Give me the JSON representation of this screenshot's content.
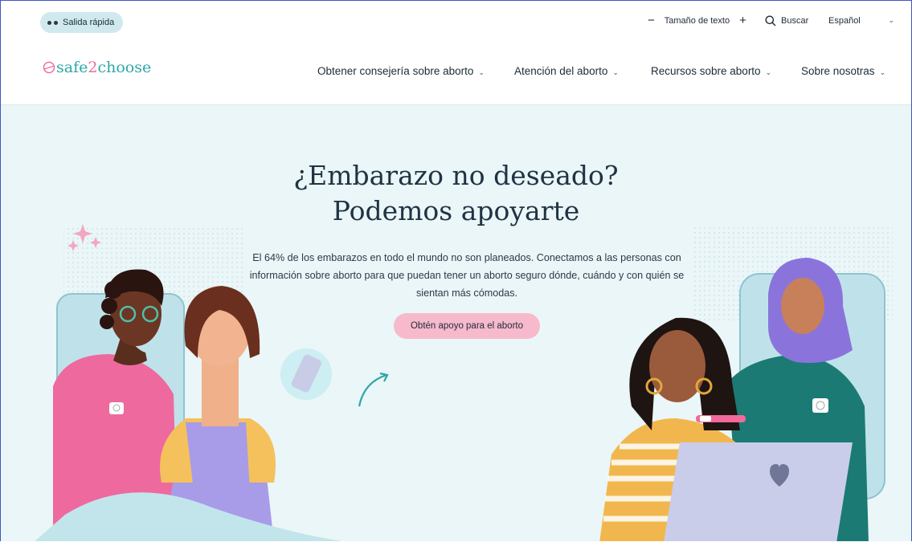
{
  "utility_bar": {
    "quick_exit_label": "Salida rápida",
    "text_size_label": "Tamaño de texto",
    "decrease_symbol": "−",
    "increase_symbol": "+",
    "search_label": "Buscar",
    "language_selected": "Español"
  },
  "header": {
    "logo_part1": "safe",
    "logo_part2": "2",
    "logo_part3": "choose",
    "nav": [
      {
        "label": "Obtener consejería sobre aborto"
      },
      {
        "label": "Atención del aborto"
      },
      {
        "label": "Recursos sobre aborto"
      },
      {
        "label": "Sobre nosotras"
      }
    ]
  },
  "hero": {
    "title_line1": "¿Embarazo no deseado?",
    "title_line2": "Podemos apoyarte",
    "subtitle": "El 64% de los embarazos en todo el mundo no son planeados. Conectamos a las personas con información sobre aborto para que puedan tener un aborto seguro dónde, cuándo y con quién se sientan más cómodas.",
    "cta_label": "Obtén apoyo para el aborto"
  },
  "colors": {
    "brand_teal": "#2ea7a8",
    "brand_pink": "#ec6fa1",
    "hero_background": "#eaf6f7",
    "cta_background": "#f7b9cc",
    "quick_exit_background": "#cfe9ef"
  },
  "icons": [
    "eyes-icon",
    "minus-icon",
    "plus-icon",
    "search-icon",
    "chevron-down-icon",
    "logo-mark-icon",
    "sparkle-icon",
    "curved-arrow-icon",
    "heart-icon"
  ]
}
